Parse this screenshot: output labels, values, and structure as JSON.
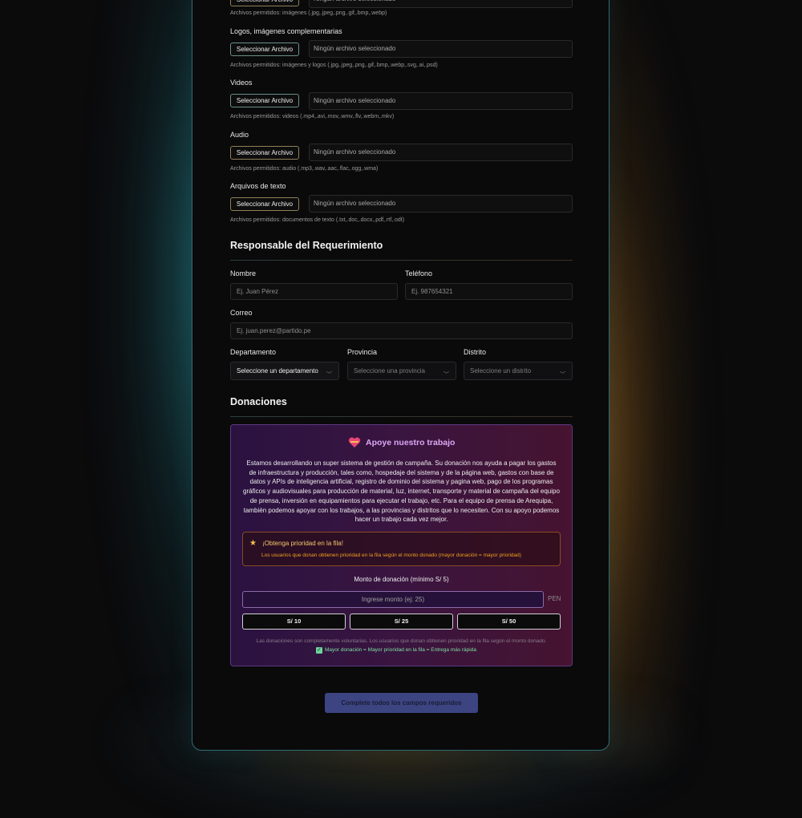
{
  "upload_sections": {
    "button_label": "Seleccionar Archivo",
    "empty_text": "Ningún archivo seleccionado",
    "images_hint": "Archivos permitidos: imágenes (.jpg,.jpeg,.png,.gif,.bmp,.webp)",
    "logos": {
      "label": "Logos, imágenes complementarias",
      "hint": "Archivos permitidos: imágenes y logos (.jpg,.jpeg,.png,.gif,.bmp,.webp,.svg,.ai,.psd)"
    },
    "videos": {
      "label": "Videos",
      "hint": "Archivos permitidos: videos (.mp4,.avi,.mov,.wmv,.flv,.webm,.mkv)"
    },
    "audio": {
      "label": "Audio",
      "hint": "Archivos permitidos: audio (.mp3,.wav,.aac,.flac,.ogg,.wma)"
    },
    "text": {
      "label": "Arquivos de texto",
      "hint": "Archivos permitidos: documentos de texto (.txt,.doc,.docx,.pdf,.rtf,.odt)"
    }
  },
  "responsible": {
    "title": "Responsable del Requerimiento",
    "name_label": "Nombre",
    "name_placeholder": "Ej. Juan Pérez",
    "phone_label": "Teléfono",
    "phone_placeholder": "Ej. 987654321",
    "email_label": "Correo",
    "email_placeholder": "Ej. juan.perez@partido.pe",
    "dept_label": "Departamento",
    "dept_value": "Seleccione un departamento",
    "prov_label": "Provincia",
    "prov_value": "Seleccione una provincia",
    "dist_label": "Distrito",
    "dist_value": "Seleccione un distrito"
  },
  "donations": {
    "title": "Donaciones",
    "card_icon": "heart-icon",
    "card_title": "Apoye nuestro trabajo",
    "description": "Estamos desarrollando un super sistema de gestión de campaña. Su donación nos ayuda a pagar los gastos de infraestructura y producción, tales como, hospedaje del sistema y de la página web, gastos con base de datos y APIs de inteligencia artificial, registro de dominio del sistema y pagina web, pago de los programas gráficos y audiovisuales para producción de material, luz, internet, transporte y material de campaña del equipo de prensa, inversión en equipamientos para ejecutar el trabajo, etc. Para el equipo de prensa de Arequipa, también podemos apoyar con los trabajos, a las provincias y distritos que lo necesiten. Con su apoyo podemos hacer un trabajo cada vez mejor.",
    "priority_title": "¡Obtenga prioridad en la fila!",
    "priority_text": "Los usuarios que donan obtienen prioridad en la fila según el monto donado (mayor donación = mayor prioridad)",
    "amount_label": "Monto de donación (mínimo S/ 5)",
    "amount_placeholder": "Ingrese monto (ej: 25)",
    "currency": "PEN",
    "quick_amounts": [
      "S/ 10",
      "S/ 25",
      "S/ 50"
    ],
    "footnote": "Las donaciones son completamente voluntarias. Los usuarios que donan obtienen prioridad en la fila según el monto donado.",
    "footnote_check": "Mayor donación = Mayor prioridad en la fila = Entrega más rápida"
  },
  "submit_label": "Complete todos los campos requeridos",
  "colors": {
    "accent_teal": "#4aa8a8",
    "accent_gold": "#c88a30",
    "submit": "#3c4482",
    "priority_text": "#f0a020"
  }
}
